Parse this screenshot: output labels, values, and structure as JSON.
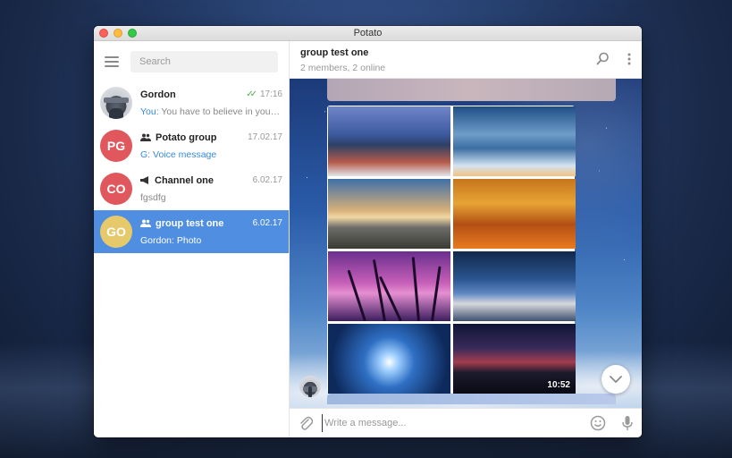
{
  "window": {
    "title": "Potato"
  },
  "sidebar": {
    "search_placeholder": "Search",
    "chats": [
      {
        "name": "Gordon",
        "time": "17:16",
        "prefix": "You: ",
        "preview": "You have to believe in yourself",
        "avatar_initials": "",
        "avatar_color": "#c8ccd2",
        "type": "user",
        "read": true
      },
      {
        "name": "Potato group",
        "time": "17.02.17",
        "prefix": "G: ",
        "preview": "Voice message",
        "avatar_initials": "PG",
        "avatar_color": "#e0585e",
        "type": "group"
      },
      {
        "name": "Channel one",
        "time": "6.02.17",
        "prefix": "",
        "preview": "fgsdfg",
        "avatar_initials": "CO",
        "avatar_color": "#e0585e",
        "type": "channel"
      },
      {
        "name": "group test one",
        "time": "6.02.17",
        "prefix": "",
        "preview": "Gordon: Photo",
        "avatar_initials": "GO",
        "avatar_color": "#e6c96a",
        "type": "group",
        "active": true
      }
    ]
  },
  "conversation": {
    "title": "group test one",
    "subtitle": "2 members, 2 online",
    "media_grid": {
      "video_duration": "10:52"
    },
    "composer_placeholder": "Write a message..."
  },
  "colors": {
    "accent": "#4f8ee0",
    "avatar_red": "#e0585e",
    "avatar_yellow": "#e6c96a",
    "read_check": "#4cb050"
  },
  "icons": [
    "menu-icon",
    "search-icon",
    "more-vertical-icon",
    "attach-icon",
    "emoji-icon",
    "microphone-icon",
    "chevron-down-icon",
    "group-icon",
    "megaphone-icon",
    "double-check-icon"
  ]
}
